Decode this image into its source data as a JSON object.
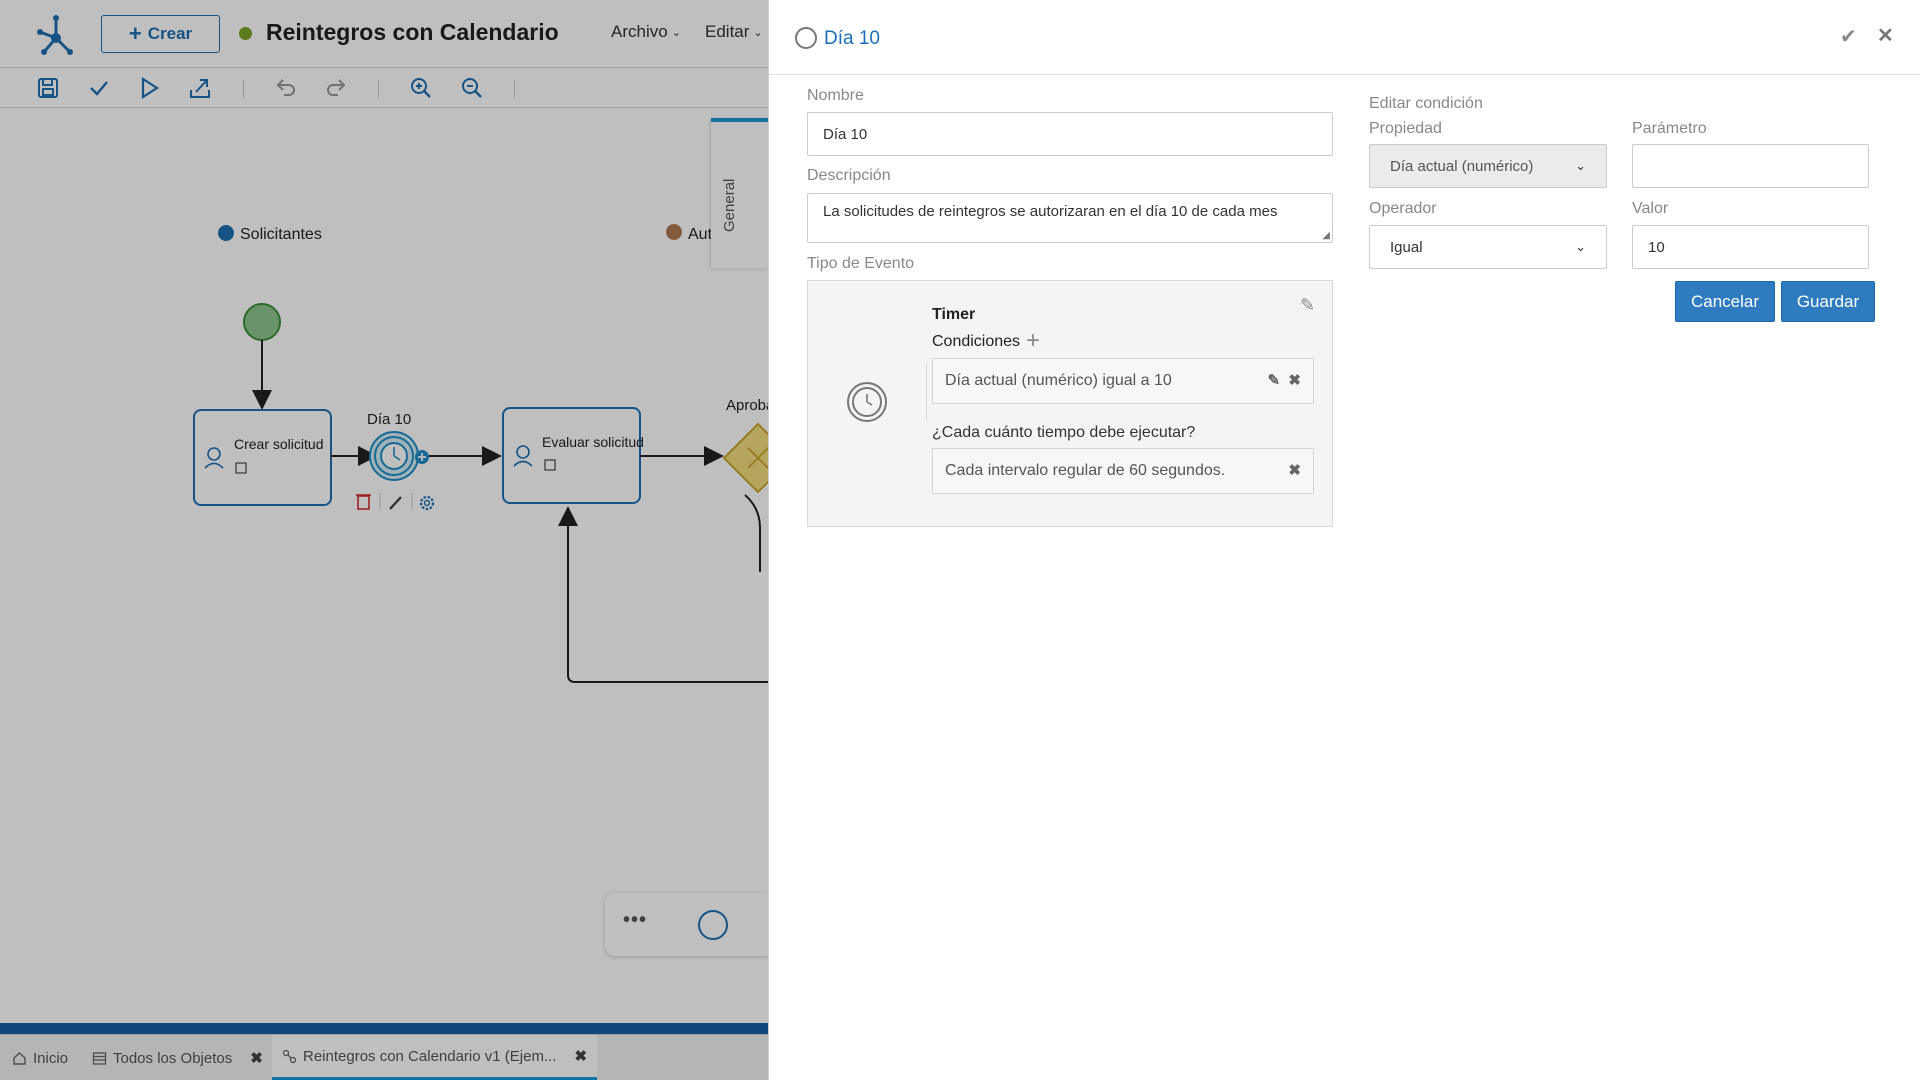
{
  "app": {
    "create_label": "Crear",
    "process_title": "Reintegros con Calendario",
    "menus": {
      "archivo": "Archivo",
      "editar": "Editar"
    },
    "status_color": "#7da32a",
    "accent": "#1f6fb2"
  },
  "toolbar": {
    "icons": [
      "save-icon",
      "check-icon",
      "play-icon",
      "export-icon",
      "undo-icon",
      "redo-icon",
      "zoom-in-icon",
      "zoom-out-icon"
    ]
  },
  "diagram": {
    "lane_solicitantes": "Solicitantes",
    "lane_autorizantes": "Aut",
    "task_crear": "Crear solicitud",
    "task_evaluar": "Evaluar solicitud",
    "timer_event": "Día 10",
    "gateway": "Aproba"
  },
  "general_tab": "General",
  "bottom_tabs": [
    {
      "label": "Inicio"
    },
    {
      "label": "Todos los Objetos"
    },
    {
      "label": "Reintegros con Calendario v1 (Ejem..."
    }
  ],
  "panel": {
    "title": "Día 10",
    "nombre": {
      "label": "Nombre",
      "value": "Día 10"
    },
    "descripcion": {
      "label": "Descripción",
      "value": "La solicitudes de reintegros se autorizaran en el día 10 de cada mes"
    },
    "tipo_evento": {
      "label": "Tipo de Evento",
      "type": "Timer",
      "conditions_label": "Condiciones",
      "condition": "Día actual (numérico) igual a 10",
      "frequency_question": "¿Cada cuánto tiempo debe ejecutar?",
      "frequency": "Cada intervalo regular de 60 segundos."
    },
    "edit_condition": {
      "title": "Editar condición",
      "propiedad_label": "Propiedad",
      "propiedad_value": "Día actual (numérico)",
      "parametro_label": "Parámetro",
      "parametro_value": "",
      "operador_label": "Operador",
      "operador_value": "Igual",
      "valor_label": "Valor",
      "valor_value": "10",
      "cancel": "Cancelar",
      "save": "Guardar"
    }
  }
}
